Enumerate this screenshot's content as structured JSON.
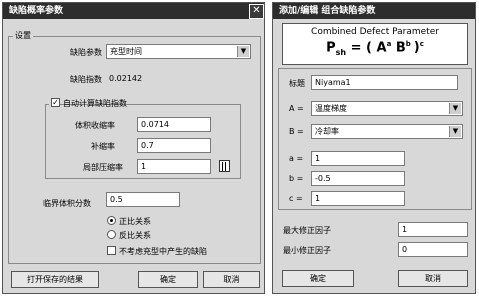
{
  "left_dialog": {
    "title": "缺陷概率参数",
    "close_glyph": "✕",
    "settings_group": "设置",
    "defect_param_label": "缺陷参数",
    "defect_param_value": "充型时间",
    "defect_index_label": "缺陷指数",
    "defect_index_value": "0.02142",
    "auto_calc_label": "自动计算缺陷指数",
    "auto_calc_checked": "✓",
    "volume_shrink_label": "体积收缩率",
    "volume_shrink_value": "0.0714",
    "feed_rate_label": "补缩率",
    "feed_rate_value": "0.7",
    "local_compress_label": "局部压缩率",
    "local_compress_value": "1",
    "critical_volume_label": "临界体积分数",
    "critical_volume_value": "0.5",
    "radio_direct_label": "正比关系",
    "radio_inverse_label": "反比关系",
    "ignore_fill_label": "不考虑充型中产生的缺陷",
    "open_saved_button": "打开保存的结果",
    "ok_button": "确定",
    "cancel_button": "取消"
  },
  "right_dialog": {
    "title": "添加/编辑 组合缺陷参数",
    "formula_title": "Combined Defect Parameter",
    "formula_lhs": "P",
    "formula_lhs_sub": "sh",
    "formula_eq": " = ( A",
    "formula_a_sup": "a",
    "formula_b": " B",
    "formula_b_sup": "b",
    "formula_close": ")",
    "formula_c_sup": "c",
    "name_label": "标题",
    "name_value": "Niyama1",
    "a_label": "A =",
    "a_value": "温度梯度",
    "b_label": "B =",
    "b_value": "冷却率",
    "small_a_label": "a =",
    "small_a_value": "1",
    "small_b_label": "b =",
    "small_b_value": "-0.5",
    "small_c_label": "c =",
    "small_c_value": "1",
    "max_factor_label": "最大修正因子",
    "max_factor_value": "1",
    "min_factor_label": "最小修正因子",
    "min_factor_value": "0",
    "ok_button": "确定",
    "cancel_button": "取消"
  }
}
